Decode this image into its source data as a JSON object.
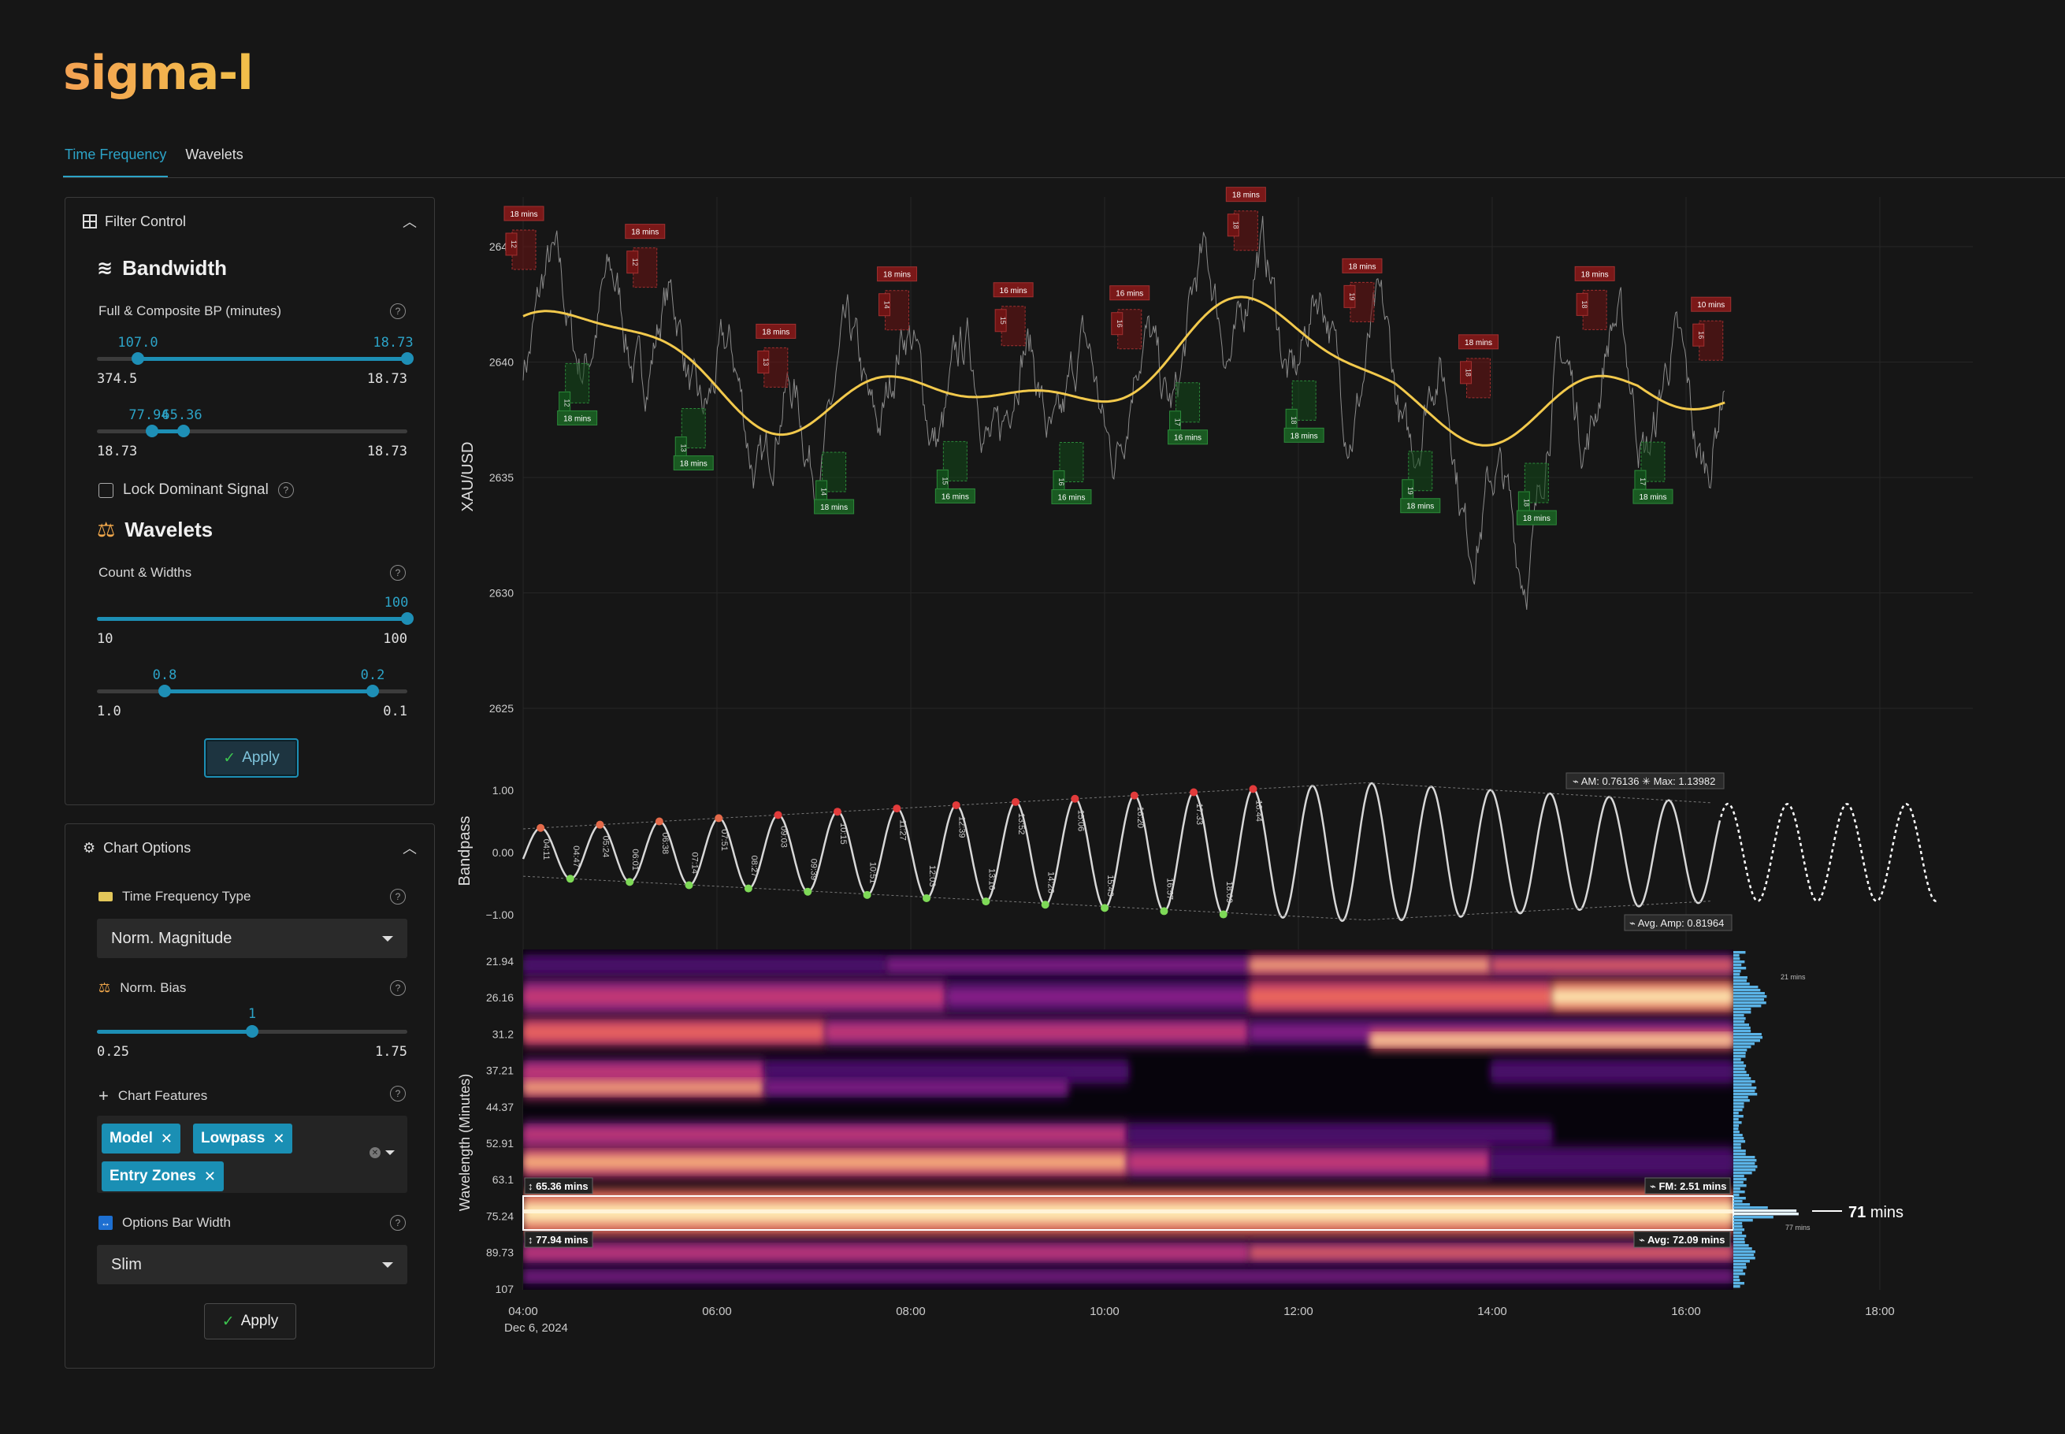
{
  "app": {
    "logo": "sigma-l"
  },
  "tabs": [
    {
      "label": "Time Frequency",
      "active": true
    },
    {
      "label": "Wavelets",
      "active": false
    }
  ],
  "filter_control": {
    "title": "Filter Control",
    "bandwidth": {
      "title": "Bandwidth",
      "label": "Full & Composite BP (minutes)",
      "slider1": {
        "low_value": "107.0",
        "high_value": "18.73",
        "min": "374.5",
        "max": "18.73"
      },
      "slider2": {
        "low_value": "77.94",
        "high_value": "65.36",
        "min": "107.0",
        "max": "18.73"
      }
    },
    "lock_dominant": {
      "label": "Lock Dominant Signal",
      "checked": false
    },
    "wavelets": {
      "title": "Wavelets",
      "label": "Count & Widths",
      "slider1": {
        "value": "100",
        "min": "10",
        "max": "100"
      },
      "slider2": {
        "low_value": "0.8",
        "high_value": "0.2",
        "min": "1.0",
        "max": "0.1"
      }
    },
    "apply_label": "Apply"
  },
  "chart_options": {
    "title": "Chart Options",
    "tf_type": {
      "label": "Time Frequency Type",
      "value": "Norm. Magnitude"
    },
    "norm_bias": {
      "label": "Norm. Bias",
      "value": "1",
      "min": "0.25",
      "max": "1.75"
    },
    "features": {
      "label": "Chart Features",
      "tags": [
        "Model",
        "Lowpass",
        "Entry Zones"
      ]
    },
    "bar_width": {
      "label": "Options Bar Width",
      "value": "Slim"
    },
    "apply_label": "Apply"
  },
  "chart_data": [
    {
      "type": "line",
      "ylabel": "XAU/USD",
      "y_ticks": [
        "2625",
        "2630",
        "2635",
        "2640",
        "2645"
      ],
      "ylim": [
        2622,
        2648
      ],
      "lowpass": {
        "color": "#f2c94c"
      },
      "zones": [
        {
          "t": 4.0,
          "kind": "high",
          "label": "18 mins",
          "n": "12"
        },
        {
          "t": 4.55,
          "kind": "low",
          "label": "18 mins",
          "n": "12"
        },
        {
          "t": 5.25,
          "kind": "high",
          "label": "18 mins",
          "n": "12"
        },
        {
          "t": 5.75,
          "kind": "low",
          "label": "18 mins",
          "n": "13"
        },
        {
          "t": 6.6,
          "kind": "high",
          "label": "18 mins",
          "n": "13"
        },
        {
          "t": 7.2,
          "kind": "low",
          "label": "18 mins",
          "n": "14"
        },
        {
          "t": 7.85,
          "kind": "high",
          "label": "18 mins",
          "n": "14"
        },
        {
          "t": 8.45,
          "kind": "low",
          "label": "16 mins",
          "n": "15"
        },
        {
          "t": 9.05,
          "kind": "high",
          "label": "16 mins",
          "n": "15"
        },
        {
          "t": 9.65,
          "kind": "low",
          "label": "16 mins",
          "n": "16"
        },
        {
          "t": 10.25,
          "kind": "high",
          "label": "16 mins",
          "n": "16"
        },
        {
          "t": 10.85,
          "kind": "low",
          "label": "16 mins",
          "n": "17"
        },
        {
          "t": 11.45,
          "kind": "high",
          "label": "18 mins",
          "n": "18"
        },
        {
          "t": 12.05,
          "kind": "low",
          "label": "18 mins",
          "n": "18"
        },
        {
          "t": 12.65,
          "kind": "high",
          "label": "18 mins",
          "n": "19"
        },
        {
          "t": 13.25,
          "kind": "low",
          "label": "18 mins",
          "n": "19"
        },
        {
          "t": 13.85,
          "kind": "high",
          "label": "18 mins",
          "n": "18"
        },
        {
          "t": 14.45,
          "kind": "low",
          "label": "18 mins",
          "n": "18"
        },
        {
          "t": 15.05,
          "kind": "high",
          "label": "18 mins",
          "n": "18"
        },
        {
          "t": 15.65,
          "kind": "low",
          "label": "18 mins",
          "n": "17"
        },
        {
          "t": 16.25,
          "kind": "high",
          "label": "10 mins",
          "n": "16"
        }
      ]
    },
    {
      "type": "line",
      "ylabel": "Bandpass",
      "y_ticks": [
        "1.00",
        "0.00",
        "−1.00"
      ],
      "am": "AM: 0.76136",
      "max": "Max: 1.13982",
      "avg_amp": "Avg. Amp: 0.81964",
      "turns": [
        "04:11",
        "04:47",
        "05:24",
        "06:01",
        "06:38",
        "07:14",
        "07:51",
        "08:27",
        "09:03",
        "09:39",
        "10:15",
        "10:51",
        "11:27",
        "12:03",
        "12:39",
        "13:16",
        "13:52",
        "14:28",
        "15:06",
        "15:43",
        "16:20",
        "16:57",
        "17:33",
        "18:09",
        "18:44"
      ]
    },
    {
      "type": "heatmap",
      "ylabel": "Wavelength (Minutes)",
      "y_ticks": [
        "21.94",
        "26.16",
        "31.2",
        "37.21",
        "44.37",
        "52.91",
        "63.1",
        "75.24",
        "89.73",
        "107"
      ],
      "band_top": "65.36 mins",
      "band_bottom": "77.94 mins",
      "fm": "FM: 2.51 mins",
      "avg": "Avg: 72.09 mins",
      "dominant_value": "71",
      "dominant_unit": "mins",
      "peak_small_1": "21 mins",
      "peak_small_2": "77 mins",
      "x_ticks": [
        "04:00",
        "06:00",
        "08:00",
        "10:00",
        "12:00",
        "14:00",
        "16:00",
        "18:00"
      ],
      "date": "Dec 6, 2024"
    }
  ]
}
